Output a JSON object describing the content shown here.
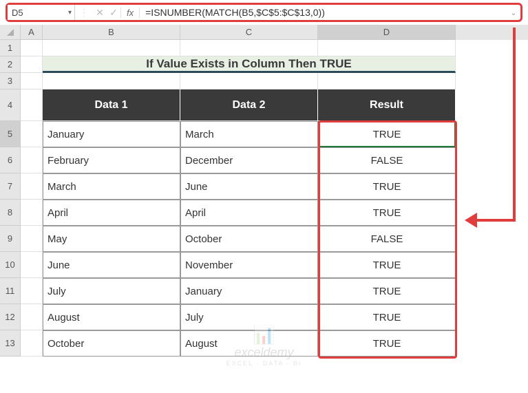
{
  "nameBox": "D5",
  "formula": "=ISNUMBER(MATCH(B5,$C$5:$C$13,0))",
  "fxLabel": "fx",
  "columns": [
    "A",
    "B",
    "C",
    "D"
  ],
  "rowNumbers": [
    "1",
    "2",
    "3",
    "4",
    "5",
    "6",
    "7",
    "8",
    "9",
    "10",
    "11",
    "12",
    "13"
  ],
  "title": "If Value Exists in Column Then TRUE",
  "headers": {
    "b": "Data 1",
    "c": "Data 2",
    "d": "Result"
  },
  "rows": [
    {
      "b": "January",
      "c": "March",
      "d": "TRUE"
    },
    {
      "b": "February",
      "c": "December",
      "d": "FALSE"
    },
    {
      "b": "March",
      "c": "June",
      "d": "TRUE"
    },
    {
      "b": "April",
      "c": "April",
      "d": "TRUE"
    },
    {
      "b": "May",
      "c": "October",
      "d": "FALSE"
    },
    {
      "b": "June",
      "c": "November",
      "d": "TRUE"
    },
    {
      "b": "July",
      "c": "January",
      "d": "TRUE"
    },
    {
      "b": "August",
      "c": "July",
      "d": "TRUE"
    },
    {
      "b": "October",
      "c": "August",
      "d": "TRUE"
    }
  ],
  "watermark": {
    "text": "exceldemy",
    "sub": "EXCEL · DATA · BI"
  }
}
